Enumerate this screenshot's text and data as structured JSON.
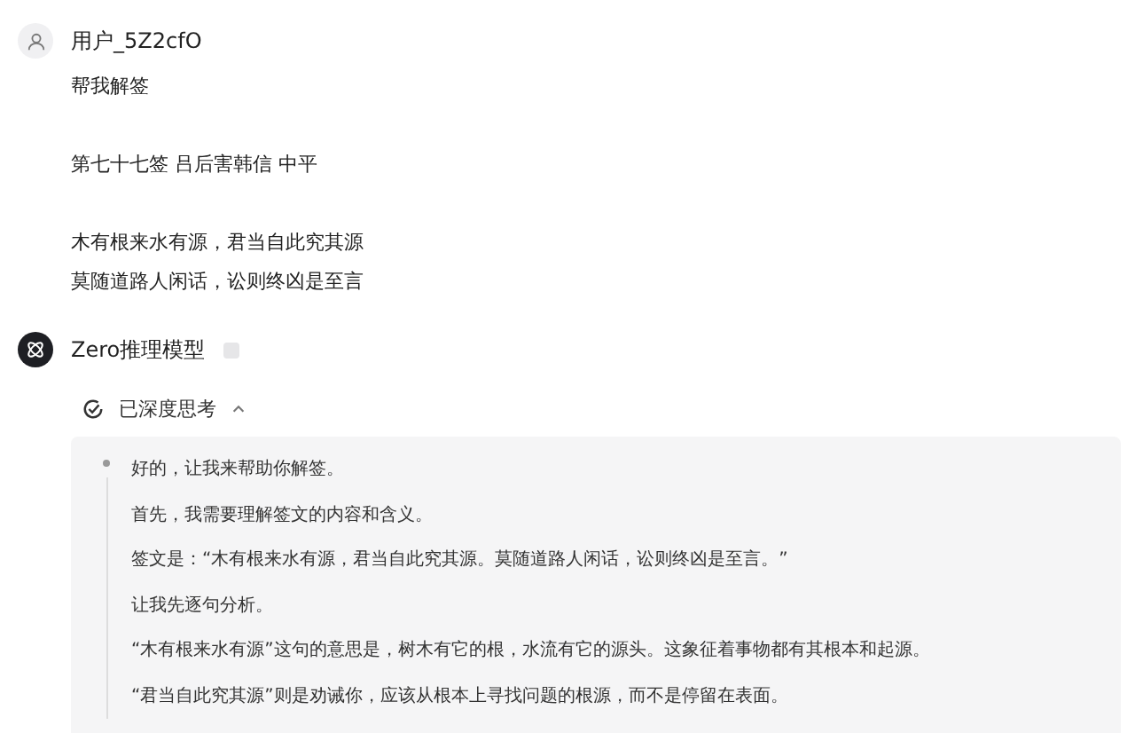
{
  "user_message": {
    "username": "用户_5Z2cfO",
    "paragraphs": [
      [
        "帮我解签"
      ],
      [
        "第七十七签 吕后害韩信 中平"
      ],
      [
        "木有根来水有源，君当自此究其源",
        "莫随道路人闲话，讼则终凶是至言"
      ]
    ]
  },
  "model_reply": {
    "model_name": "Zero推理模型",
    "thinking": {
      "label": "已深度思考",
      "expanded": true,
      "paragraphs": [
        "好的，让我来帮助你解签。",
        "首先，我需要理解签文的内容和含义。",
        "签文是：“木有根来水有源，君当自此究其源。莫随道路人闲话，讼则终凶是至言。”",
        "让我先逐句分析。",
        "“木有根来水有源”这句的意思是，树木有它的根，水流有它的源头。这象征着事物都有其根本和起源。",
        "“君当自此究其源”则是劝诫你，应该从根本上寻找问题的根源，而不是停留在表面。"
      ]
    }
  }
}
